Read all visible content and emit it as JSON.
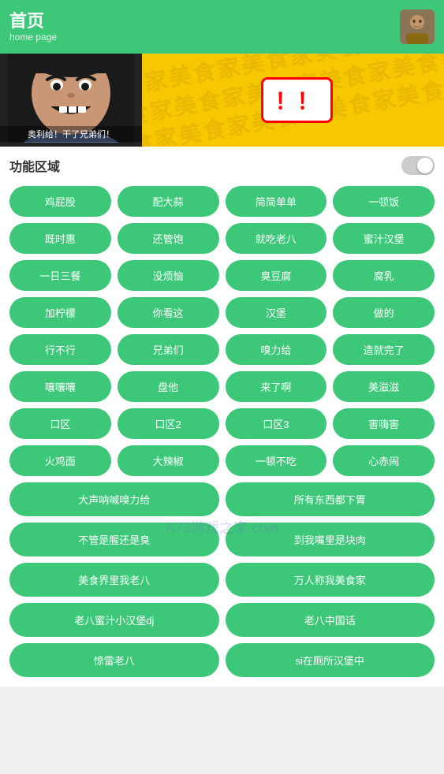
{
  "header": {
    "title": "首页",
    "subtitle": "home page",
    "avatar_label": "avatar"
  },
  "banner": {
    "caption": "奥利给！干了兄弟们！",
    "pattern_text": "美食家美食家美食家美食家美食家美食家美食家美食家",
    "exclaim": "！！"
  },
  "func_area": {
    "title": "功能区域",
    "toggle_label": "toggle"
  },
  "buttons_grid": [
    "鸡屁股",
    "配大蒜",
    "简简单单",
    "一顿饭",
    "既时惠",
    "还管饱",
    "就吃老八",
    "蜜汁汉堡",
    "一日三餐",
    "没烦恼",
    "臭豆腐",
    "腐乳",
    "加柠檬",
    "你看这",
    "汉堡",
    "做的",
    "行不行",
    "兄弟们",
    "嗅力给",
    "造就完了",
    "嚷嚷嚷",
    "盘他",
    "来了啊",
    "美滋滋",
    "口区",
    "口区2",
    "口区3",
    "害嗨害",
    "火鸡面",
    "大辣椒",
    "一顿不吃",
    "心赤闹"
  ],
  "buttons_wide": [
    {
      "label": "大声呐喊嗅力给",
      "half": true
    },
    {
      "label": "所有东西都下胃",
      "half": true
    },
    {
      "label": "不管是腥还是臭",
      "half": true
    },
    {
      "label": "到我嘴里是块肉",
      "half": true
    },
    {
      "label": "美食界里我老八",
      "half": true
    },
    {
      "label": "万人称我美食家",
      "half": true
    },
    {
      "label": "老八蜜汁小汉堡dj",
      "half": true
    },
    {
      "label": "老八中国话",
      "half": true
    },
    {
      "label": "惊雷老八",
      "half": true
    },
    {
      "label": "si在厕所汉堡中",
      "half": true
    }
  ],
  "watermark": "K73游戏之家.com"
}
